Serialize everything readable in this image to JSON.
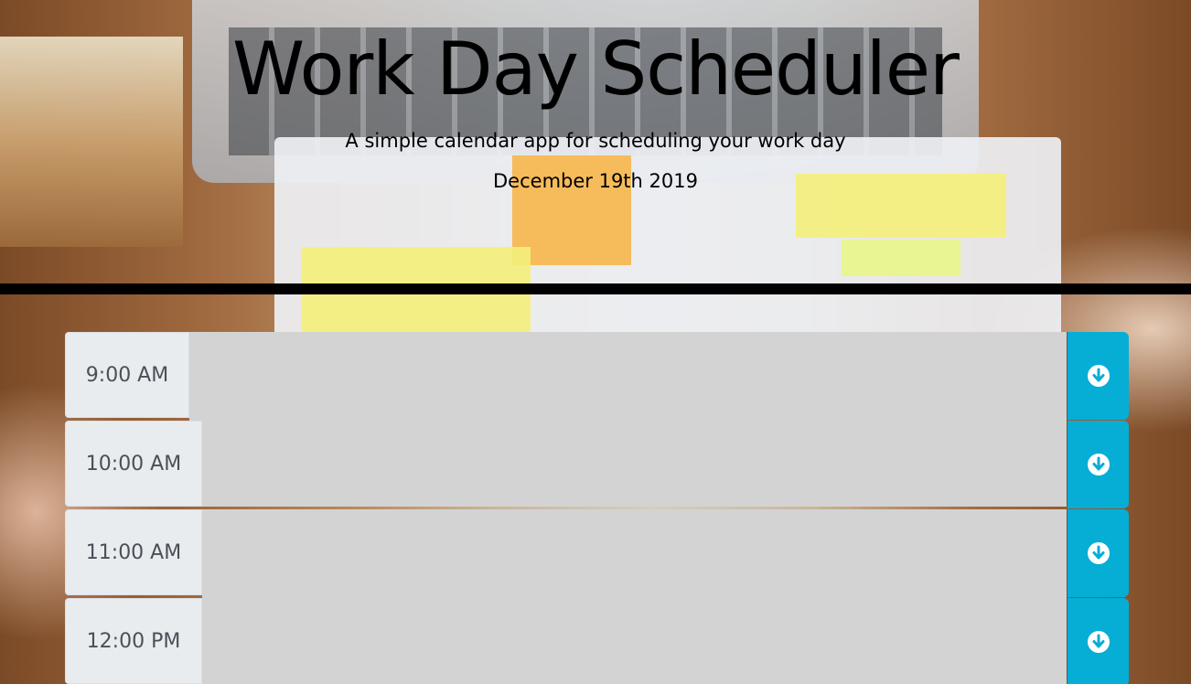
{
  "header": {
    "title": "Work Day Scheduler",
    "lead": "A simple calendar app for scheduling your work day",
    "current_day": "December 19th 2019"
  },
  "schedule": {
    "rows": [
      {
        "hour": "9:00 AM",
        "description": "",
        "save_icon": "arrow-circle-down-icon"
      },
      {
        "hour": "10:00 AM",
        "description": "",
        "save_icon": "arrow-circle-down-icon"
      },
      {
        "hour": "11:00 AM",
        "description": "",
        "save_icon": "arrow-circle-down-icon"
      },
      {
        "hour": "12:00 PM",
        "description": "",
        "save_icon": "arrow-circle-down-icon"
      }
    ]
  },
  "colors": {
    "save_button": "#06aed5",
    "description_bg": "#d3d3d3",
    "hour_bg": "#e9ecef",
    "divider": "#000000"
  }
}
